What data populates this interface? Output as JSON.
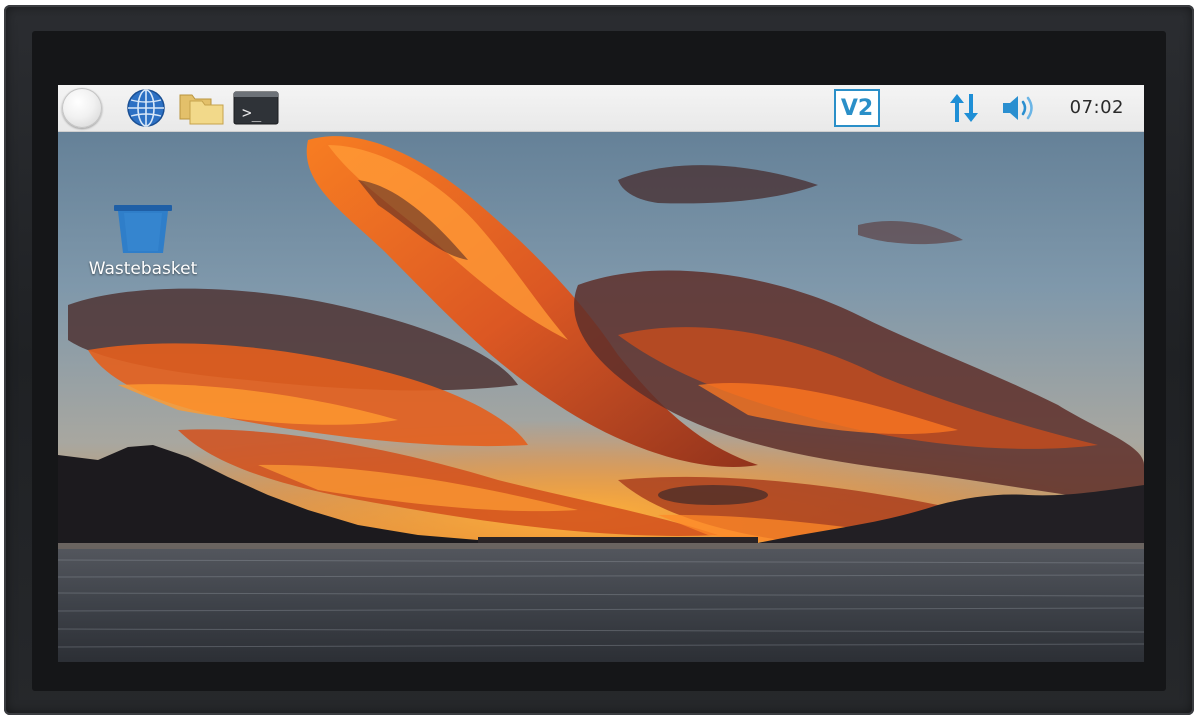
{
  "taskbar": {
    "menu_icon": "raspberry-menu-icon",
    "browser_icon": "globe-browser-icon",
    "files_icon": "folders-icon",
    "terminal_icon": "terminal-icon",
    "terminal_glyph": ">_",
    "vnc_icon": "vnc-viewer-icon",
    "vnc_label": "V2",
    "network_icon": "network-up-down-icon",
    "volume_icon": "speaker-volume-icon",
    "clock": "07:02"
  },
  "desktop": {
    "icons": [
      {
        "label": "Wastebasket",
        "icon": "wastebasket-icon"
      }
    ]
  },
  "colors": {
    "taskbar_bg": "#eeeeee",
    "accent_blue": "#2a8fc8",
    "bezel": "#232528",
    "wastebasket_blue": "#2f7ec9"
  }
}
